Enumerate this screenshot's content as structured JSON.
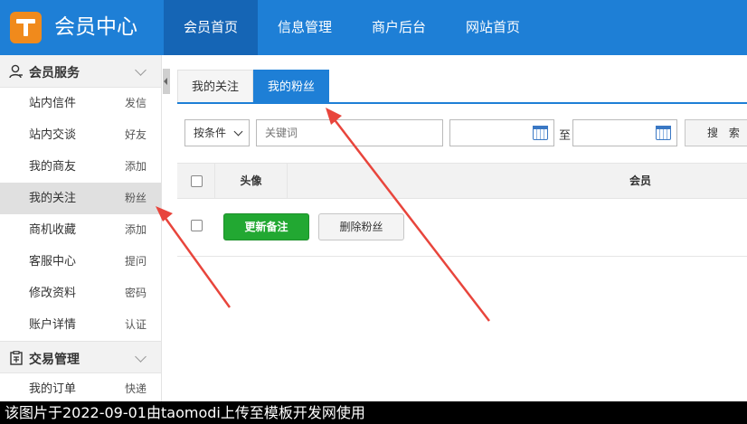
{
  "header": {
    "title": "会员中心",
    "nav": [
      "会员首页",
      "信息管理",
      "商户后台",
      "网站首页"
    ]
  },
  "sidebar": {
    "group1": {
      "title": "会员服务",
      "items": [
        {
          "label": "站内信件",
          "action": "发信"
        },
        {
          "label": "站内交谈",
          "action": "好友"
        },
        {
          "label": "我的商友",
          "action": "添加"
        },
        {
          "label": "我的关注",
          "action": "粉丝"
        },
        {
          "label": "商机收藏",
          "action": "添加"
        },
        {
          "label": "客服中心",
          "action": "提问"
        },
        {
          "label": "修改资料",
          "action": "密码"
        },
        {
          "label": "账户详情",
          "action": "认证"
        }
      ]
    },
    "group2": {
      "title": "交易管理",
      "items": [
        {
          "label": "我的订单",
          "action": "快递"
        }
      ]
    }
  },
  "tabs": [
    "我的关注",
    "我的粉丝"
  ],
  "filter": {
    "condition": "按条件",
    "keyword_placeholder": "关键词",
    "to_label": "至",
    "search_label": "搜 索"
  },
  "table": {
    "headers": {
      "avatar": "头像",
      "member": "会员"
    }
  },
  "actions": {
    "update_note": "更新备注",
    "delete_fans": "删除粉丝"
  },
  "watermark": "该图片于2022-09-01由taomodi上传至模板开发网使用",
  "colors": {
    "primary": "#1e7fd6",
    "primary_dark": "#1565b5",
    "green": "#22a832",
    "arrow": "#e8453c"
  }
}
